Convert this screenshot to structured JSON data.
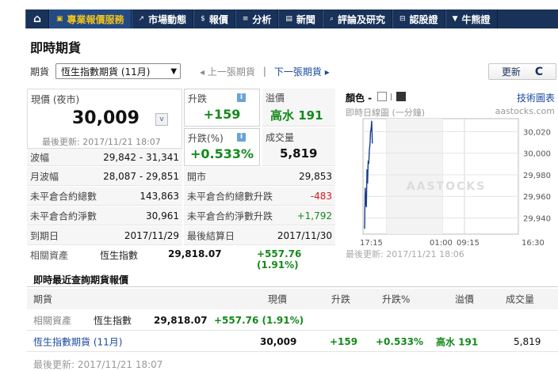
{
  "nav": {
    "home_icon": "home-icon",
    "items": [
      {
        "icon": "▣",
        "label": "專業報價服務"
      },
      {
        "icon": "↗",
        "label": "市場動態"
      },
      {
        "icon": "$",
        "label": "報價"
      },
      {
        "icon": "≡",
        "label": "分析"
      },
      {
        "icon": "▤",
        "label": "新聞"
      },
      {
        "icon": "⌕",
        "label": "評論及研究"
      },
      {
        "icon": "⊟",
        "label": "認股證"
      },
      {
        "icon": "▼",
        "label": "牛熊證"
      }
    ]
  },
  "page_title": "即時期貨",
  "selector": {
    "label": "期貨",
    "selected": "恆生指數期貨 (11月)",
    "prev": "◂ 上一張期貨",
    "separator": "|",
    "next": "下一張期貨 ▸",
    "refresh": "更新",
    "refresh_icon": "C"
  },
  "quote": {
    "price_label": "現價 (夜市)",
    "price": "30,009",
    "price_dropdown": "v",
    "updated": "最後更新: 2017/11/21 18:07",
    "change_label": "升跌",
    "change": "+159",
    "change_pct_label": "升跌(%)",
    "change_pct": "+0.533%",
    "premium_label": "溢價",
    "premium": "高水 191",
    "volume_label": "成交量",
    "volume": "5,819",
    "rows": [
      {
        "l1": "波幅",
        "v1": "29,842 - 31,341"
      },
      {
        "l1": "月波幅",
        "v1": "28,087 - 29,851",
        "l2": "開市",
        "v2": "29,853"
      },
      {
        "l1": "未平倉合約總數",
        "v1": "143,863",
        "l2": "未平倉合約總數升跌",
        "v2": "-483"
      },
      {
        "l1": "未平倉合約淨數",
        "v1": "30,961",
        "l2": "未平倉合約淨數升跌",
        "v2": "+1,792"
      },
      {
        "l1": "到期日",
        "v1": "2017/11/29",
        "l2": "最後結算日",
        "v2": "2017/11/30"
      }
    ],
    "related": {
      "label": "相關資產",
      "name": "恆生指數",
      "value": "29,818.07",
      "change": "+557.76 (1.91%)"
    }
  },
  "chart_panel": {
    "color_label": "顏色 -",
    "tech_link": "技術圖表",
    "subtitle": "即時日線圖 (一分鐘)",
    "source": "aastocks.com",
    "watermark": "AASTOCKS",
    "updated": "最後更新: 2017/11/21 18:06"
  },
  "chart_data": {
    "type": "line",
    "title": "",
    "xlabel": "",
    "ylabel": "",
    "ylim": [
      29925,
      30032
    ],
    "y_ticks": [
      30020,
      30000,
      29980,
      29960,
      29940
    ],
    "y_tick_labels": [
      "30,020",
      "30,000",
      "29,980",
      "29,960",
      "29,940"
    ],
    "x_ticks": [
      "17:15",
      "01:00",
      "09:15",
      "16:30"
    ],
    "series": [
      {
        "values": [
          29930,
          29968,
          29955,
          29950,
          29985,
          29972,
          29993,
          29990,
          30003,
          30008,
          30020,
          30023,
          30030,
          30009
        ]
      }
    ],
    "grid": true
  },
  "recent": {
    "title": "即時最近查詢期貨報價",
    "headers": [
      "期貨",
      "現價",
      "升跌",
      "升跌%",
      "溢價",
      "成交量"
    ],
    "related_row": {
      "label": "相關資產",
      "name": "恆生指數",
      "value": "29,818.07",
      "change": "+557.76 (1.91%)"
    },
    "row": {
      "name": "恆生指數期貨 (11月)",
      "price": "30,009",
      "change": "+159",
      "pct": "+0.533%",
      "premium": "高水 191",
      "volume": "5,819"
    },
    "last_updated": "最後更新: 2017/11/21 18:07"
  }
}
